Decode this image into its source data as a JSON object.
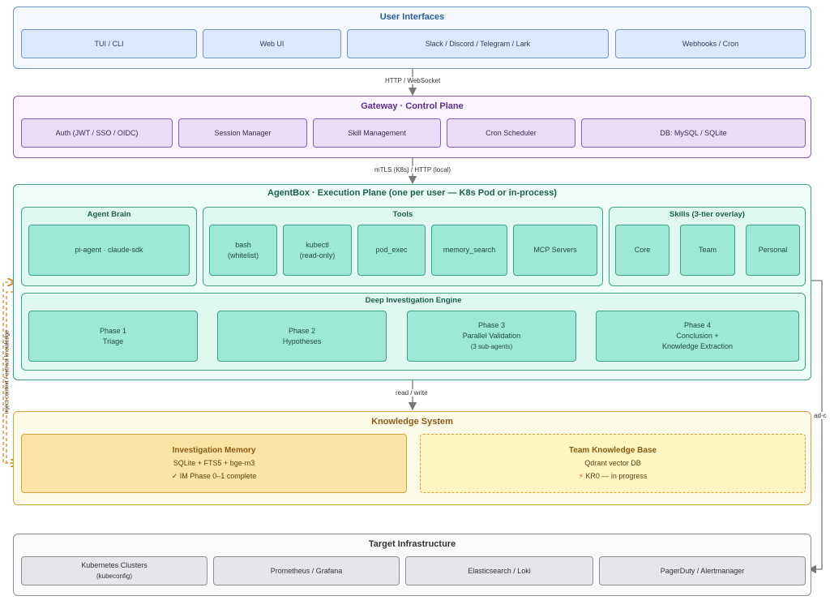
{
  "user_interfaces": {
    "title": "User Interfaces",
    "items": [
      "TUI / CLI",
      "Web UI",
      "Slack / Discord / Telegram / Lark",
      "Webhooks / Cron"
    ]
  },
  "conn1": "HTTP / WebSocket",
  "gateway": {
    "title": "Gateway · Control Plane",
    "items": [
      "Auth (JWT / SSO / OIDC)",
      "Session Manager",
      "Skill Management",
      "Cron Scheduler",
      "DB: MySQL / SQLite"
    ]
  },
  "conn2": "mTLS (K8s) / HTTP (local)",
  "agentbox": {
    "title": "AgentBox · Execution Plane (one per user — K8s Pod or in-process)",
    "brain": {
      "title": "Agent Brain",
      "node": "pi-agent · claude-sdk"
    },
    "tools": {
      "title": "Tools",
      "items": [
        {
          "l1": "bash",
          "l2": "(whitelist)"
        },
        {
          "l1": "kubectl",
          "l2": "(read-only)"
        },
        {
          "l1": "pod_exec",
          "l2": ""
        },
        {
          "l1": "memory_search",
          "l2": ""
        },
        {
          "l1": "MCP Servers",
          "l2": ""
        }
      ]
    },
    "skills": {
      "title": "Skills (3-tier overlay)",
      "items": [
        "Core",
        "Team",
        "Personal"
      ]
    },
    "engine": {
      "title": "Deep Investigation Engine",
      "phases": [
        {
          "l1": "Phase 1",
          "l2": "Triage",
          "l3": ""
        },
        {
          "l1": "Phase 2",
          "l2": "Hypotheses",
          "l3": ""
        },
        {
          "l1": "Phase 3",
          "l2": "Parallel Validation",
          "l3": "(3 sub-agents)"
        },
        {
          "l1": "Phase 4",
          "l2": "Conclusion +",
          "l3": "Knowledge Extraction"
        }
      ]
    }
  },
  "conn3": "read / write",
  "side_left": "inject context / extract knowledge",
  "side_right": "ad-c",
  "knowledge": {
    "title": "Knowledge System",
    "memory": {
      "title": "Investigation Memory",
      "line1": "SQLite + FTS5 + bge-m3",
      "line2": "✓ IM Phase 0–1 complete"
    },
    "team": {
      "title": "Team Knowledge Base",
      "line1": "Qdrant vector DB",
      "line2": "KR0 — in progress"
    }
  },
  "target": {
    "title": "Target Infrastructure",
    "items": [
      {
        "l1": "Kubernetes Clusters",
        "l2": "(kubeconfig)"
      },
      {
        "l1": "Prometheus / Grafana",
        "l2": ""
      },
      {
        "l1": "Elasticsearch / Loki",
        "l2": ""
      },
      {
        "l1": "PagerDuty / Alertmanager",
        "l2": ""
      }
    ]
  },
  "colors": {
    "ui": "#6f95c5",
    "gateway": "#8a5bb5",
    "agentbox": "#3ca08a",
    "knowledge": "#d9a23a",
    "target": "#8c8f96"
  }
}
